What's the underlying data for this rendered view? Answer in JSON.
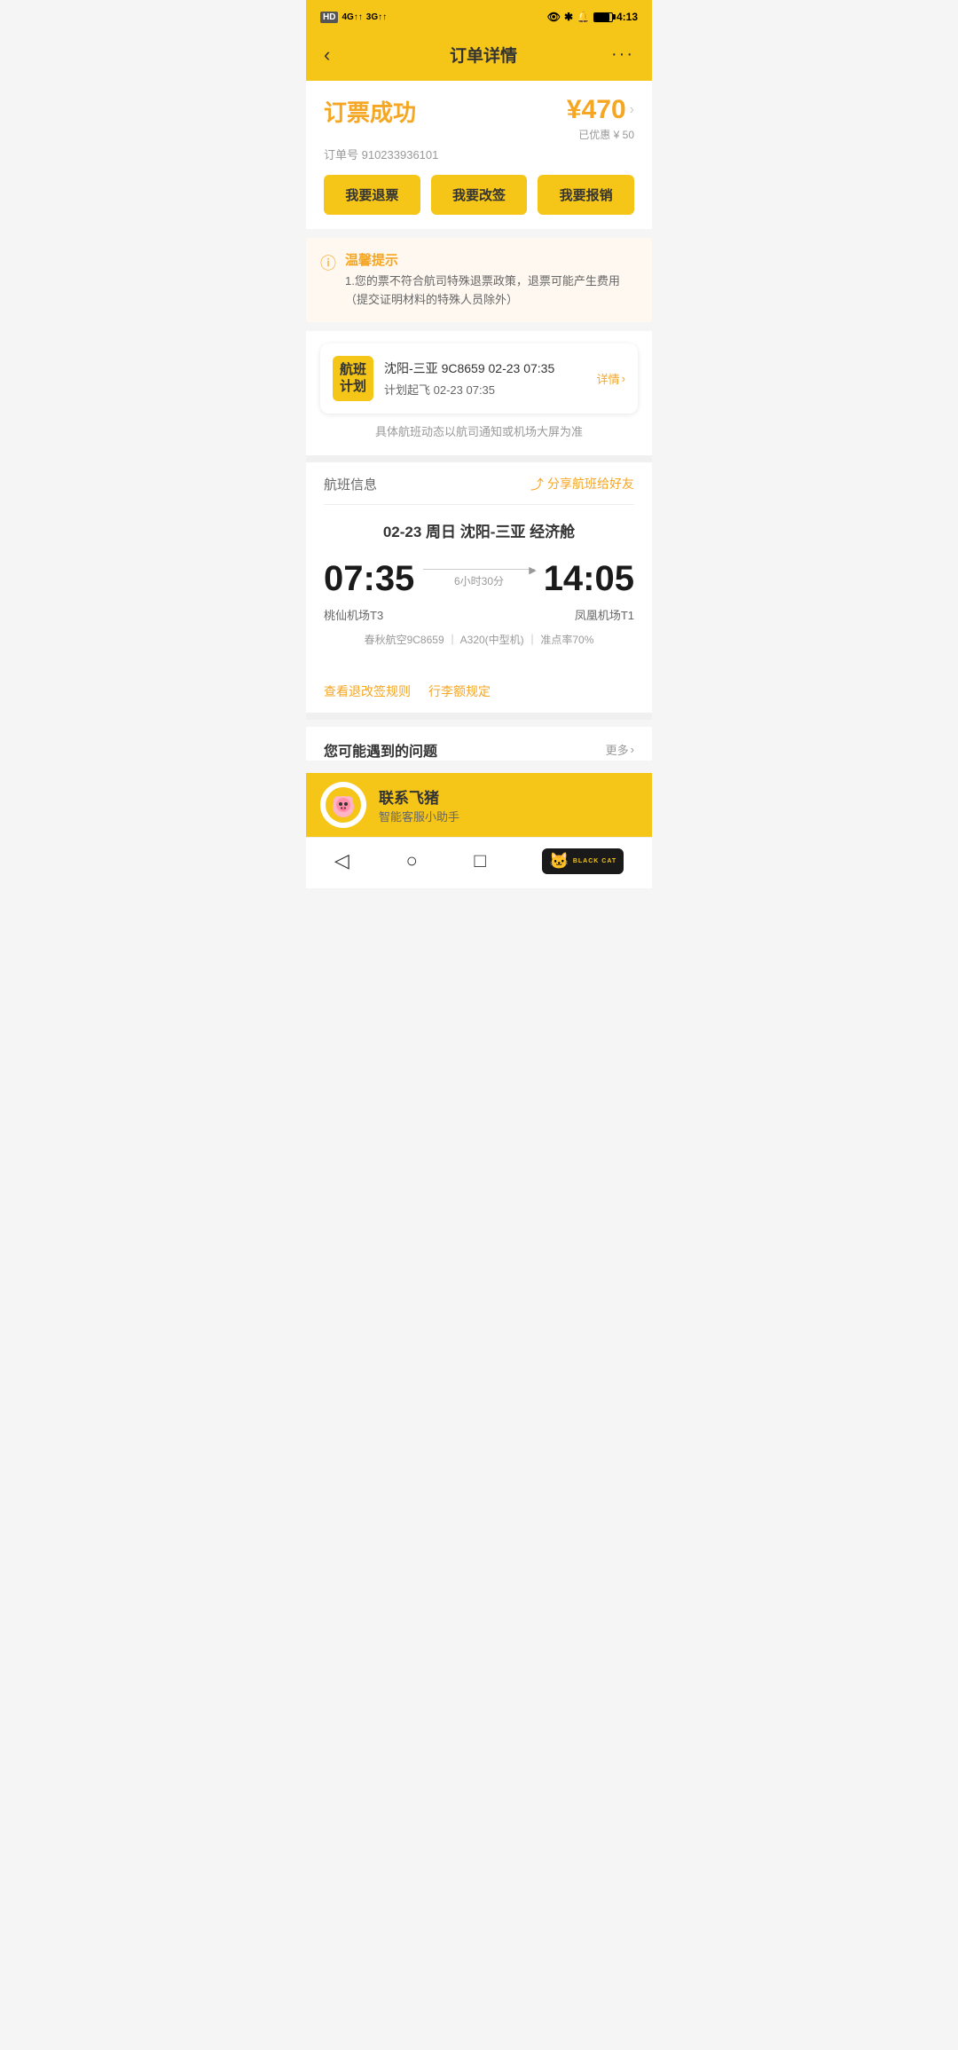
{
  "statusBar": {
    "leftLabel": "HD 4G 3G",
    "timeLabel": "4:13",
    "batteryPercent": 85
  },
  "header": {
    "backLabel": "‹",
    "title": "订单详情",
    "moreLabel": "···"
  },
  "orderSuccess": {
    "title": "订票成功",
    "priceLabel": "¥470",
    "priceArrow": "›",
    "discountLabel": "已优惠 ¥ 50",
    "orderNumberLabel": "订单号 910233936101"
  },
  "actionButtons": {
    "refund": "我要退票",
    "change": "我要改签",
    "invoice": "我要报销"
  },
  "notice": {
    "title": "温馨提示",
    "content": "1.您的票不符合航司特殊退票政策，退票可能产生费用（提交证明材料的特殊人员除外）"
  },
  "flightPlan": {
    "badgeLine1": "航班",
    "badgeLine2": "计划",
    "route": "沈阳-三亚 9C8659 02-23 07:35",
    "departure": "计划起飞 02-23 07:35",
    "detailLabel": "详情",
    "dynamicNote": "具体航班动态以航司通知或机场大屏为准"
  },
  "flightInfo": {
    "sectionLabel": "航班信息",
    "shareLabel": "分享航班给好友",
    "dateRoute": "02-23  周日  沈阳-三亚  经济舱",
    "departTime": "07:35",
    "arriveTime": "14:05",
    "duration": "6小时30分",
    "departAirport": "桃仙机场T3",
    "arriveAirport": "凤凰机场T1",
    "airline": "春秋航空9C8659",
    "aircraft": "A320(中型机)",
    "onTimeRate": "准点率70%"
  },
  "links": {
    "refundRules": "查看退改签规则",
    "luggageRules": "行李额规定"
  },
  "faq": {
    "title": "您可能遇到的问题",
    "moreLabel": "更多"
  },
  "contact": {
    "name": "联系飞猪",
    "subtitle": "智能客服小助手"
  },
  "navBar": {
    "back": "◁",
    "home": "○",
    "recent": "□"
  },
  "blackCat": {
    "icon": "🐱",
    "text": "BLACK CAT"
  }
}
